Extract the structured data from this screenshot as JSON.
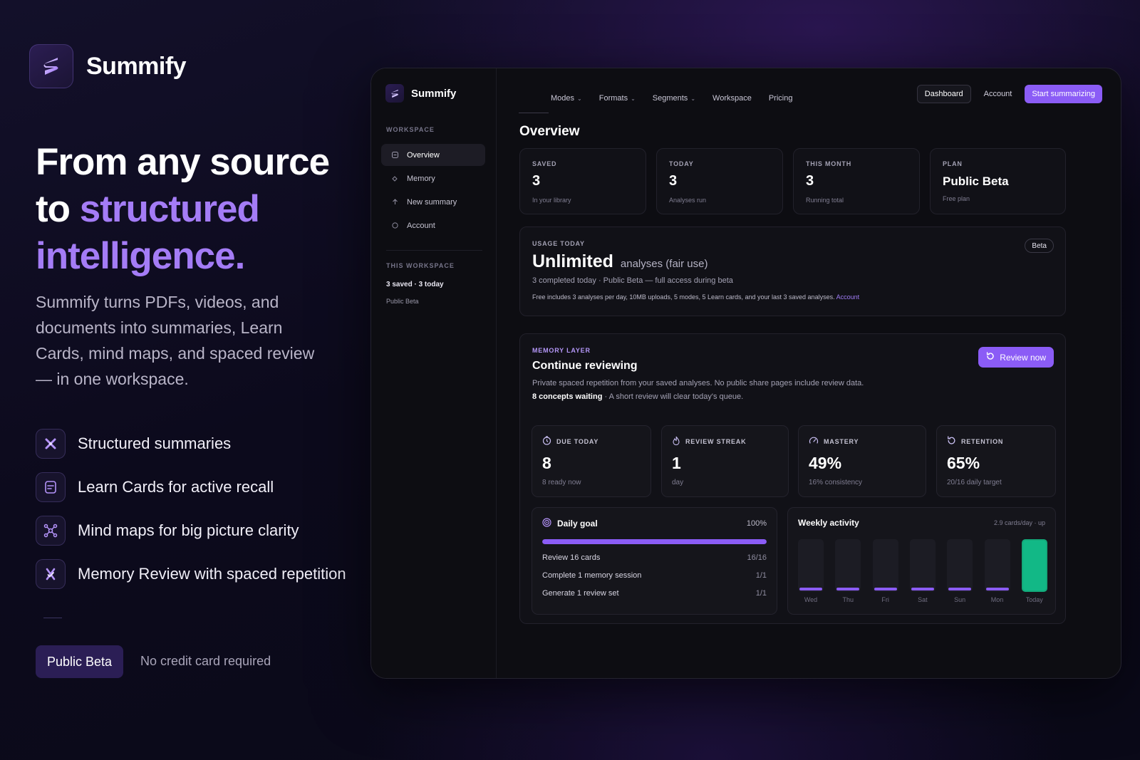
{
  "hero": {
    "brand": "Summify",
    "headline_1": "From any source",
    "headline_2": "to ",
    "headline_accent": "structured intelligence.",
    "subtext": "Summify turns PDFs, videos, and documents into summaries, Learn Cards, mind maps, and spaced review — in one workspace.",
    "features": [
      {
        "icon": "sparkle-x-icon",
        "label": "Structured summaries"
      },
      {
        "icon": "card-icon",
        "label": "Learn Cards for active recall"
      },
      {
        "icon": "mind-map-icon",
        "label": "Mind maps for big picture clarity"
      },
      {
        "icon": "brain-review-icon",
        "label": "Memory Review with spaced repetition"
      }
    ],
    "beta_pill": "Public Beta",
    "no_card": "No credit card required"
  },
  "app": {
    "brand": "Summify",
    "sidebar": {
      "section_label": "WORKSPACE",
      "items": [
        {
          "label": "Overview",
          "icon": "grid-icon",
          "active": true
        },
        {
          "label": "Memory",
          "icon": "diamond-icon",
          "active": false
        },
        {
          "label": "New summary",
          "icon": "arrow-up-icon",
          "active": false
        },
        {
          "label": "Account",
          "icon": "circle-icon",
          "active": false
        }
      ],
      "this_workspace_label": "THIS WORKSPACE",
      "stats": "3 saved · 3 today",
      "plan": "Public Beta"
    },
    "topnav": [
      "Modes",
      "Formats",
      "Segments",
      "Workspace",
      "Pricing"
    ],
    "actions": {
      "dashboard": "Dashboard",
      "account": "Account",
      "start": "Start summarizing"
    },
    "title": "Overview",
    "stats": [
      {
        "label": "SAVED",
        "value": "3",
        "sub": "In your library"
      },
      {
        "label": "TODAY",
        "value": "3",
        "sub": "Analyses run"
      },
      {
        "label": "THIS MONTH",
        "value": "3",
        "sub": "Running total"
      },
      {
        "label": "PLAN",
        "value": "Public Beta",
        "sub": "Free plan"
      }
    ],
    "usage": {
      "label": "USAGE TODAY",
      "big": "Unlimited",
      "small": "analyses (fair use)",
      "detail": "3 completed today · Public Beta — full access during beta",
      "note": "Free includes 3 analyses per day, 10MB uploads, 5 modes, 5 Learn cards, and your last 3 saved analyses.",
      "note_link": "Account",
      "badge": "Beta"
    },
    "memory": {
      "label": "MEMORY LAYER",
      "title": "Continue reviewing",
      "desc": "Private spaced repetition from your saved analyses. No public share pages include review data.",
      "waiting_bold": "8 concepts waiting",
      "waiting_rest": " · A short review will clear today's queue.",
      "review_btn": "Review now",
      "metrics": [
        {
          "icon": "timer-icon",
          "label": "DUE TODAY",
          "value": "8",
          "sub": "8 ready now"
        },
        {
          "icon": "flame-icon",
          "label": "REVIEW STREAK",
          "value": "1",
          "sub": "day"
        },
        {
          "icon": "gauge-icon",
          "label": "MASTERY",
          "value": "49%",
          "sub": "16% consistency"
        },
        {
          "icon": "refresh-icon",
          "label": "RETENTION",
          "value": "65%",
          "sub": "20/16 daily target"
        }
      ],
      "daily_goal": {
        "title": "Daily goal",
        "pct": "100%",
        "progress": 1.0,
        "rows": [
          {
            "label": "Review 16 cards",
            "count": "16/16"
          },
          {
            "label": "Complete 1 memory session",
            "count": "1/1"
          },
          {
            "label": "Generate 1 review set",
            "count": "1/1"
          }
        ]
      },
      "weekly": {
        "title": "Weekly activity",
        "meta": "2.9 cards/day · up",
        "days": [
          {
            "day": "Wed",
            "fill": 0.06
          },
          {
            "day": "Thu",
            "fill": 0.06
          },
          {
            "day": "Fri",
            "fill": 0.06
          },
          {
            "day": "Sat",
            "fill": 0.06
          },
          {
            "day": "Sun",
            "fill": 0.06
          },
          {
            "day": "Mon",
            "fill": 0.06
          },
          {
            "day": "Today",
            "fill": 1.0
          }
        ]
      }
    },
    "colors": {
      "accent": "#8b5cf6",
      "accent_text": "#a47cf6",
      "success": "#12b886"
    }
  }
}
